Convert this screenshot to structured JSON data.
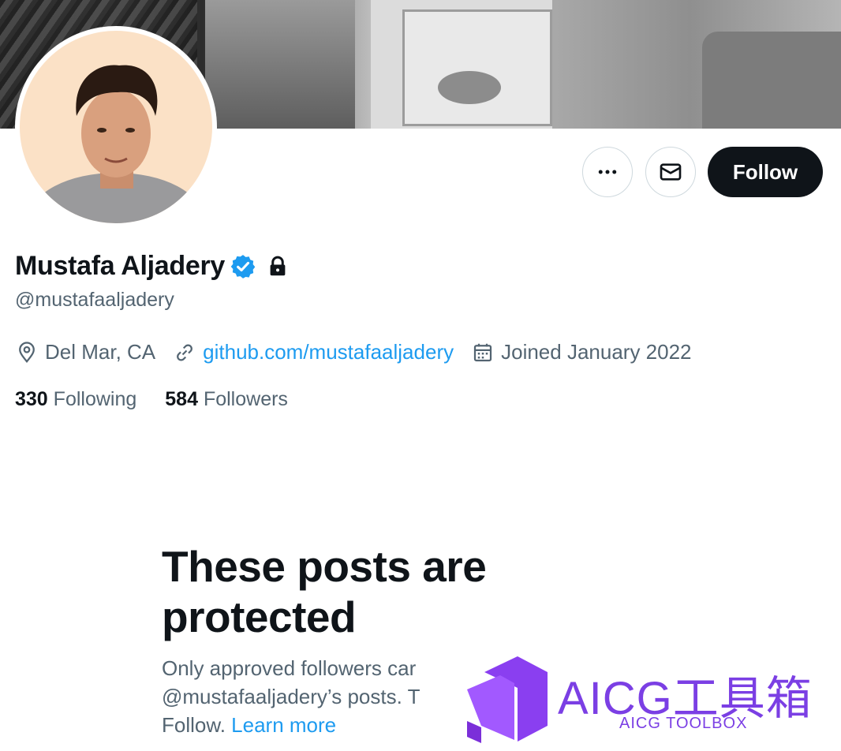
{
  "profile": {
    "name": "Mustafa Aljadery",
    "handle": "@mustafaaljadery",
    "location": "Del Mar, CA",
    "website": "github.com/mustafaaljadery",
    "joined": "Joined January 2022",
    "following_count": "330",
    "following_label": "Following",
    "followers_count": "584",
    "followers_label": "Followers"
  },
  "actions": {
    "more_icon": "more-icon",
    "message_icon": "mail-icon",
    "follow_label": "Follow"
  },
  "protected": {
    "title": "These posts are protected",
    "body_line1": "Only approved followers car",
    "body_line2": "@mustafaaljadery’s posts. T",
    "body_line3_text": "Follow. ",
    "learn_more": "Learn more"
  },
  "watermark": {
    "title": "AICG工具箱",
    "subtitle": "AICG TOOLBOX"
  },
  "colors": {
    "accent": "#1d9bf0",
    "text_primary": "#0f1419",
    "text_secondary": "#536471",
    "follow_bg": "#0f1419",
    "watermark": "#7b3fe4"
  }
}
